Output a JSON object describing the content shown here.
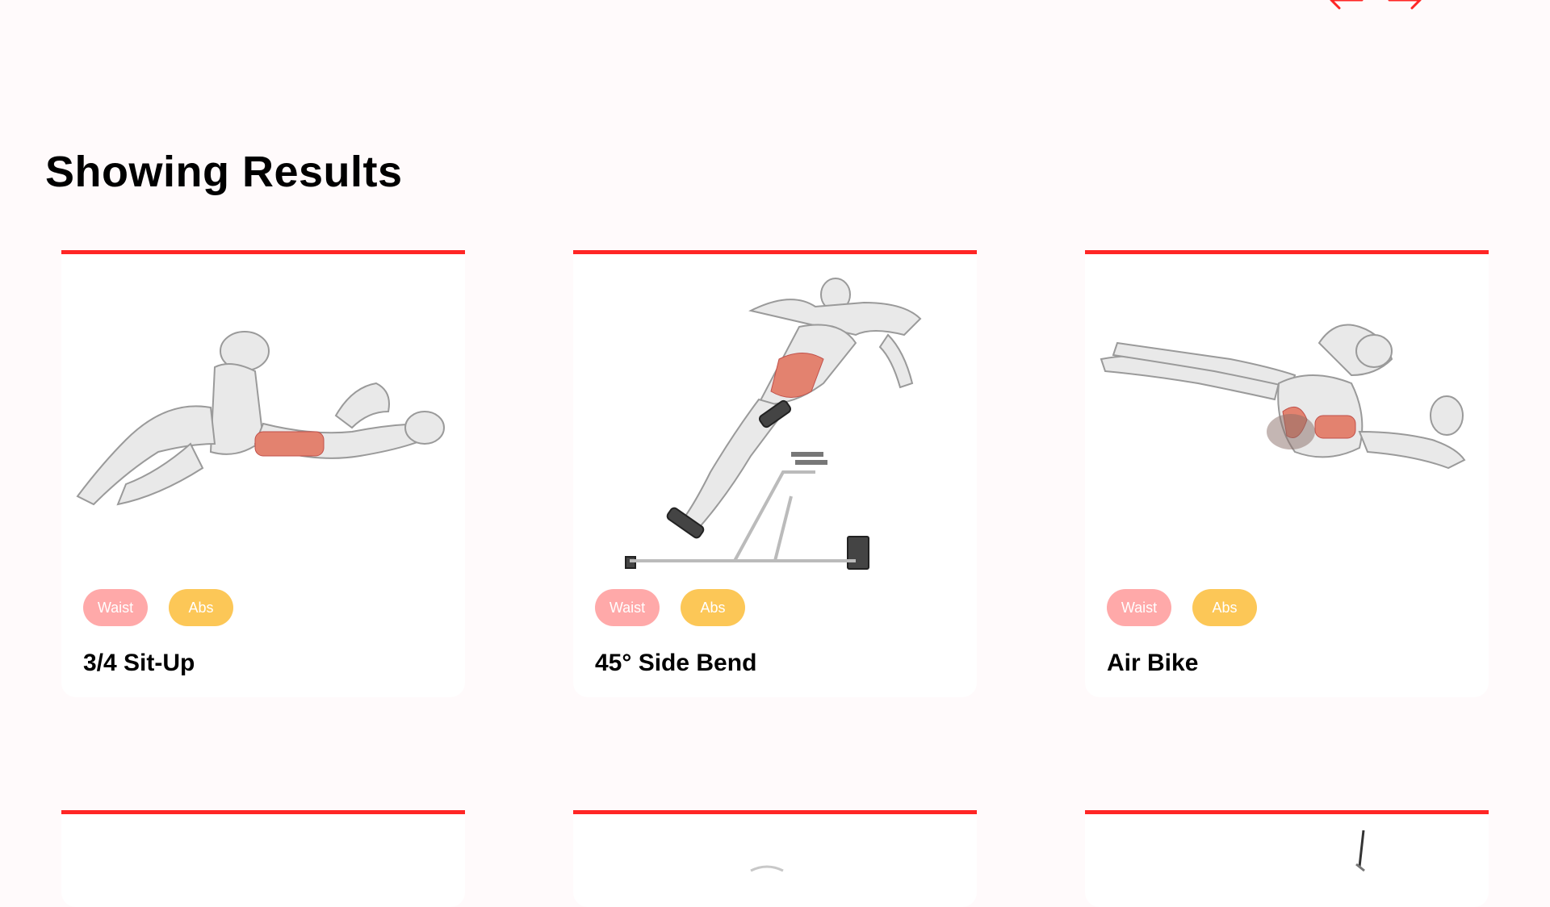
{
  "pagination": {
    "prev_icon": "arrow-left-icon",
    "next_icon": "arrow-right-icon",
    "accent_color": "#ff2625"
  },
  "results": {
    "heading": "Showing Results",
    "cards": [
      {
        "name": "3/4 Sit-Up",
        "body_part": "Waist",
        "target": "Abs",
        "illustration": "crunch-figure"
      },
      {
        "name": "45° Side Bend",
        "body_part": "Waist",
        "target": "Abs",
        "illustration": "hyperextension-bench-figure"
      },
      {
        "name": "Air Bike",
        "body_part": "Waist",
        "target": "Abs",
        "illustration": "bicycle-crunch-figure"
      }
    ]
  },
  "colors": {
    "card_border": "#ff2625",
    "tag_body": "#ffa9a9",
    "tag_target": "#fcc757",
    "background": "#fffafb"
  }
}
